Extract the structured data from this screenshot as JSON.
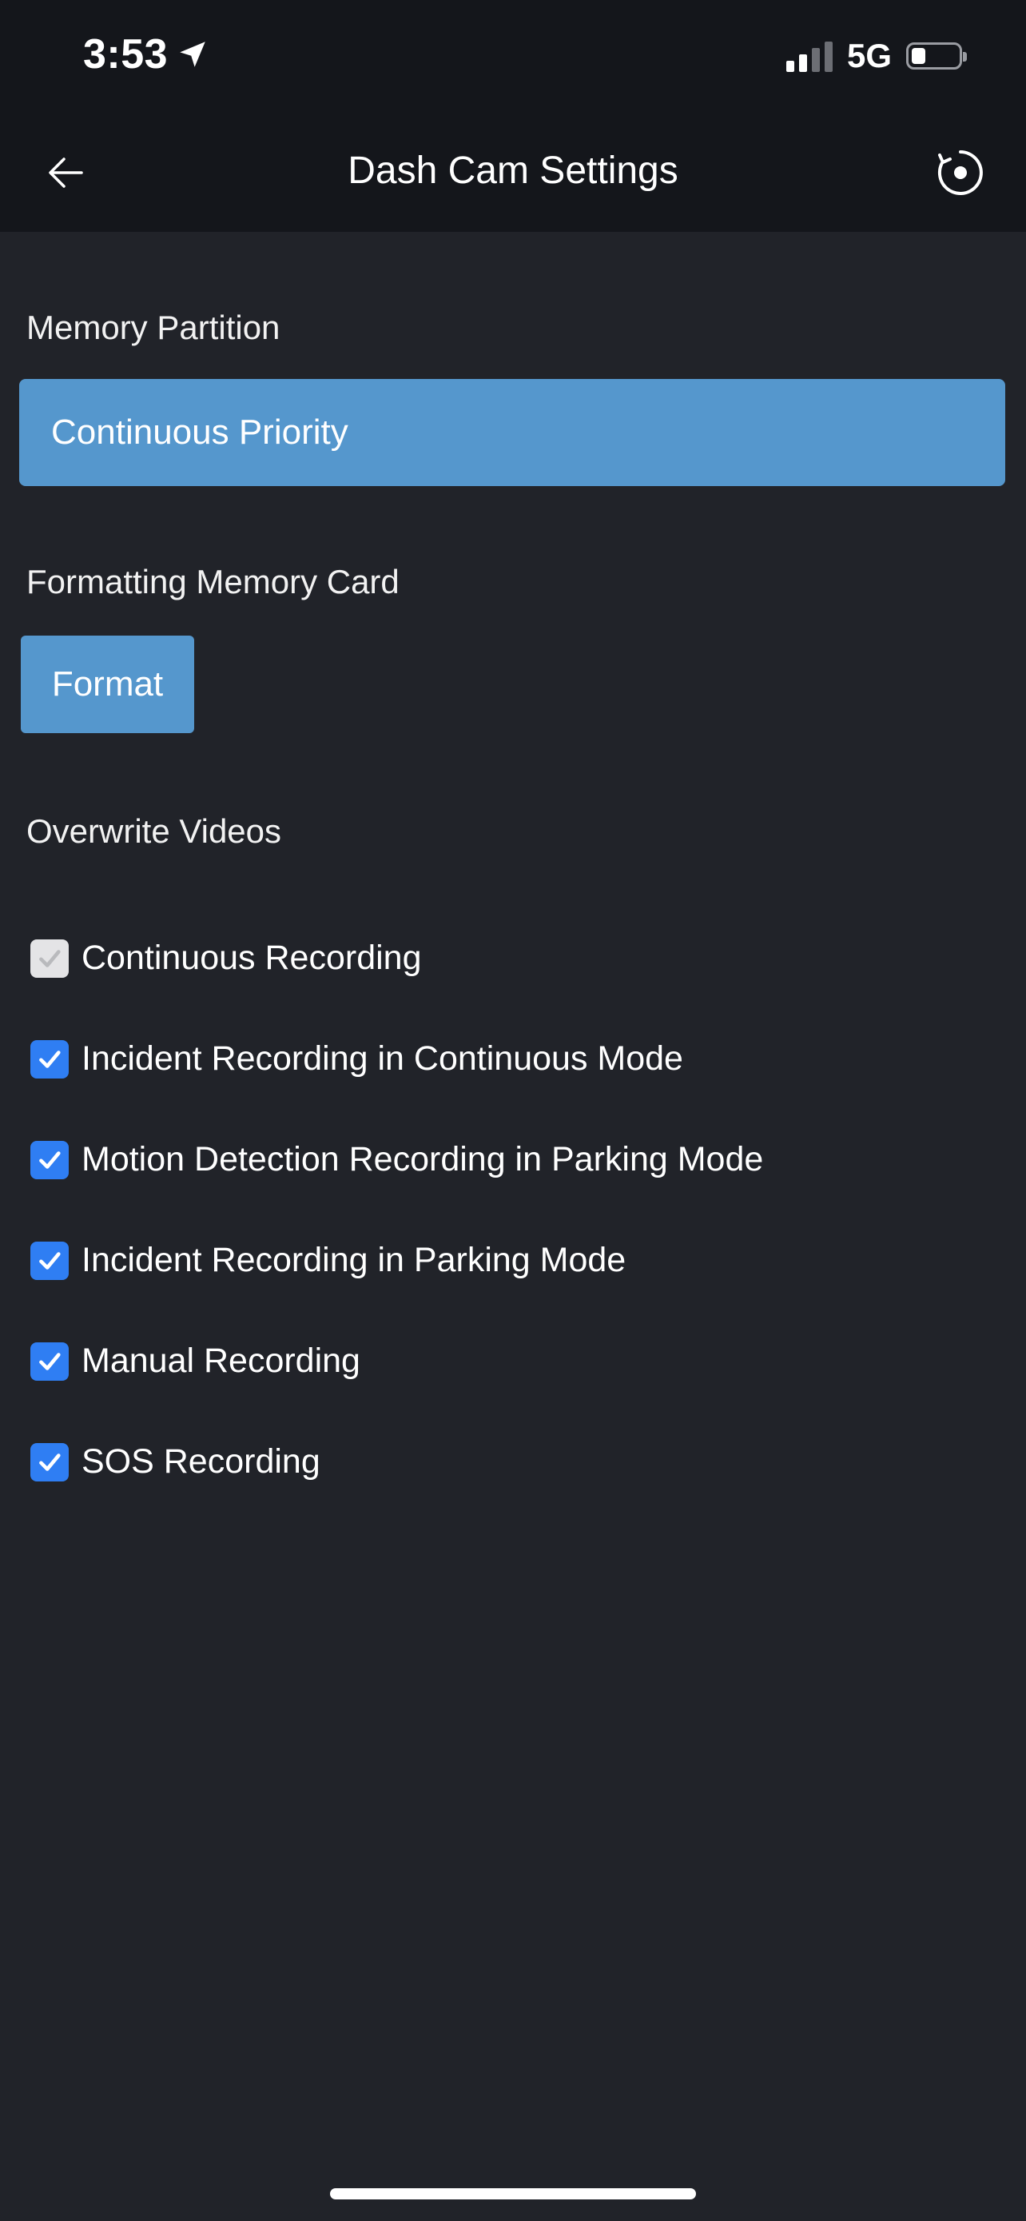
{
  "status_bar": {
    "time": "3:53",
    "network": "5G",
    "battery_level": 0.3,
    "signal_bars_active": 2
  },
  "header": {
    "title": "Dash Cam Settings"
  },
  "memory_partition": {
    "label": "Memory Partition",
    "selected_value": "Continuous Priority"
  },
  "formatting": {
    "label": "Formatting Memory Card",
    "button_label": "Format"
  },
  "overwrite": {
    "label": "Overwrite Videos",
    "items": [
      {
        "label": "Continuous Recording",
        "checked": true,
        "disabled": true
      },
      {
        "label": "Incident Recording in Continuous Mode",
        "checked": true,
        "disabled": false
      },
      {
        "label": "Motion Detection Recording in Parking Mode",
        "checked": true,
        "disabled": false
      },
      {
        "label": "Incident Recording in Parking Mode",
        "checked": true,
        "disabled": false
      },
      {
        "label": "Manual Recording",
        "checked": true,
        "disabled": false
      },
      {
        "label": "SOS Recording",
        "checked": true,
        "disabled": false
      }
    ]
  },
  "colors": {
    "background": "#212329",
    "header_background": "#14161b",
    "accent_button": "#5597cd",
    "checkbox_checked": "#2f7ef3",
    "checkbox_disabled": "#e4e4e6"
  }
}
